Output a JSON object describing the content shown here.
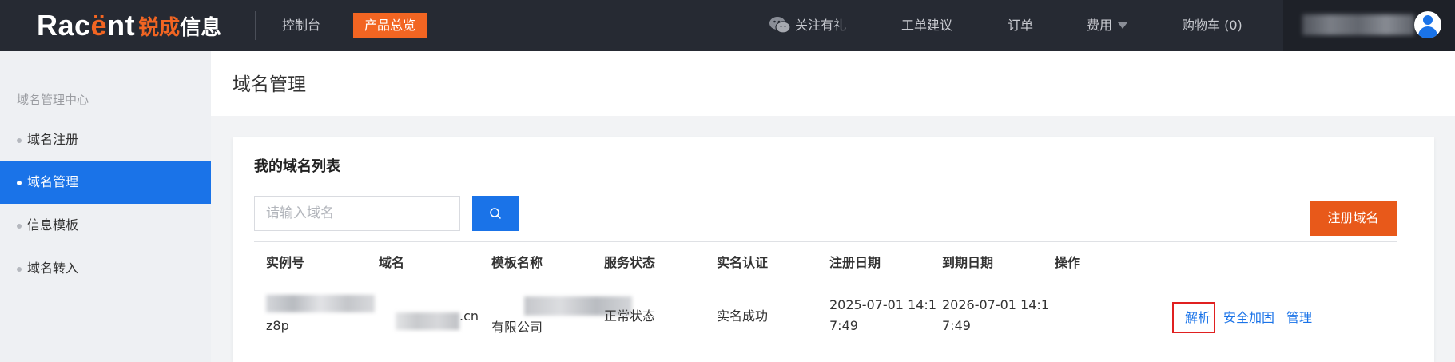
{
  "topbar": {
    "logo_en_prefix": "Rac",
    "logo_en_accent": "ë",
    "logo_en_suffix": "nt",
    "logo_cn_part1": "锐成",
    "logo_cn_part2": "信息",
    "console": "控制台",
    "overview": "产品总览",
    "follow": "关注有礼",
    "ticket": "工单建议",
    "order": "订单",
    "fee": "费用",
    "cart": "购物车 (0)"
  },
  "sidebar": {
    "title": "域名管理中心",
    "items": [
      {
        "label": "域名注册",
        "active": false
      },
      {
        "label": "域名管理",
        "active": true
      },
      {
        "label": "信息模板",
        "active": false
      },
      {
        "label": "域名转入",
        "active": false
      }
    ]
  },
  "page": {
    "title": "域名管理"
  },
  "card": {
    "title": "我的域名列表",
    "search_placeholder": "请输入域名",
    "register_button": "注册域名"
  },
  "table": {
    "headers": [
      "实例号",
      "域名",
      "模板名称",
      "服务状态",
      "实名认证",
      "注册日期",
      "到期日期",
      "操作"
    ],
    "rows": [
      {
        "instance_tail": "z8p",
        "domain_tail": ".cn",
        "template_tail": "有限公司",
        "service_status": "正常状态",
        "realname": "实名成功",
        "reg_date_line1": "2025-07-01 14:1",
        "reg_date_line2": "7:49",
        "exp_date_line1": "2026-07-01 14:1",
        "exp_date_line2": "7:49",
        "actions": [
          "解析",
          "安全加固",
          "管理"
        ]
      }
    ]
  },
  "colors": {
    "topbar_bg": "#262a33",
    "brand_orange": "#f26522",
    "primary_blue": "#1a73e8",
    "register_orange": "#e8591a",
    "highlight_red": "#e02020"
  }
}
